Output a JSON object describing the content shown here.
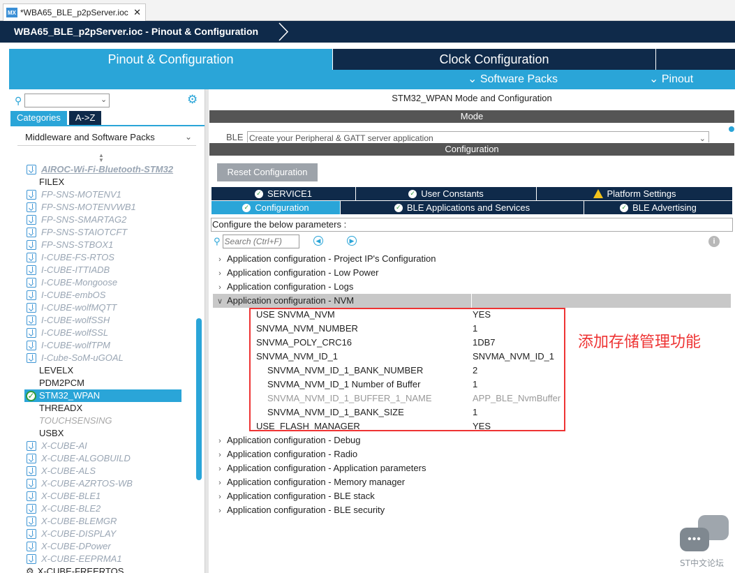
{
  "file_tab": {
    "logo": "MX",
    "title": "*WBA65_BLE_p2pServer.ioc",
    "close": "✕"
  },
  "breadcrumb": {
    "text": "WBA65_BLE_p2pServer.ioc - Pinout & Configuration"
  },
  "main_tabs": {
    "pinout_config": "Pinout & Configuration",
    "clock_config": "Clock Configuration"
  },
  "sub_menu": {
    "software_packs": "Software Packs",
    "pinout": "Pinout"
  },
  "left": {
    "category_tab": "Categories",
    "az_tab": "A->Z",
    "group": "Middleware and Software Packs",
    "tree": [
      {
        "label": "AIROC-Wi-Fi-Bluetooth-STM32",
        "kind": "dl-first"
      },
      {
        "label": "FILEX",
        "kind": "plain"
      },
      {
        "label": "FP-SNS-MOTENV1",
        "kind": "dl"
      },
      {
        "label": "FP-SNS-MOTENVWB1",
        "kind": "dl"
      },
      {
        "label": "FP-SNS-SMARTAG2",
        "kind": "dl"
      },
      {
        "label": "FP-SNS-STAIOTCFT",
        "kind": "dl"
      },
      {
        "label": "FP-SNS-STBOX1",
        "kind": "dl"
      },
      {
        "label": "I-CUBE-FS-RTOS",
        "kind": "dl"
      },
      {
        "label": "I-CUBE-ITTIADB",
        "kind": "dl"
      },
      {
        "label": "I-CUBE-Mongoose",
        "kind": "dl"
      },
      {
        "label": "I-CUBE-embOS",
        "kind": "dl"
      },
      {
        "label": "I-CUBE-wolfMQTT",
        "kind": "dl"
      },
      {
        "label": "I-CUBE-wolfSSH",
        "kind": "dl"
      },
      {
        "label": "I-CUBE-wolfSSL",
        "kind": "dl"
      },
      {
        "label": "I-CUBE-wolfTPM",
        "kind": "dl"
      },
      {
        "label": "I-Cube-SoM-uGOAL",
        "kind": "dl"
      },
      {
        "label": "LEVELX",
        "kind": "plain"
      },
      {
        "label": "PDM2PCM",
        "kind": "plain"
      },
      {
        "label": "STM32_WPAN",
        "kind": "selected"
      },
      {
        "label": "THREADX",
        "kind": "plain"
      },
      {
        "label": "TOUCHSENSING",
        "kind": "greyplain"
      },
      {
        "label": "USBX",
        "kind": "plain"
      },
      {
        "label": "X-CUBE-AI",
        "kind": "dl"
      },
      {
        "label": "X-CUBE-ALGOBUILD",
        "kind": "dl"
      },
      {
        "label": "X-CUBE-ALS",
        "kind": "dl"
      },
      {
        "label": "X-CUBE-AZRTOS-WB",
        "kind": "dl"
      },
      {
        "label": "X-CUBE-BLE1",
        "kind": "dl"
      },
      {
        "label": "X-CUBE-BLE2",
        "kind": "dl"
      },
      {
        "label": "X-CUBE-BLEMGR",
        "kind": "dl"
      },
      {
        "label": "X-CUBE-DISPLAY",
        "kind": "dl"
      },
      {
        "label": "X-CUBE-DPower",
        "kind": "dl"
      },
      {
        "label": "X-CUBE-EEPRMA1",
        "kind": "dl"
      },
      {
        "label": "X-CUBE-FREERTOS",
        "kind": "gear"
      }
    ]
  },
  "right": {
    "title": "STM32_WPAN Mode and Configuration",
    "mode_header": "Mode",
    "ble_label": "BLE",
    "ble_value": "Create your Peripheral & GATT server application",
    "config_header": "Configuration",
    "reset_button": "Reset Configuration",
    "tabs_row1": [
      "SERVICE1",
      "User Constants",
      "Platform Settings"
    ],
    "tabs_row2": [
      "Configuration",
      "BLE Applications and Services",
      "BLE Advertising"
    ],
    "params_label": "Configure the below parameters :",
    "search_placeholder": "Search (Ctrl+F)",
    "groups_before": [
      "Application configuration - Project IP's Configuration",
      "Application configuration - Low Power",
      "Application configuration - Logs"
    ],
    "open_group": "Application configuration - NVM",
    "nvm_params": [
      {
        "key": "USE SNVMA_NVM",
        "value": "YES",
        "indent": false,
        "dim": false
      },
      {
        "key": "SNVMA_NVM_NUMBER",
        "value": "1",
        "indent": false,
        "dim": false
      },
      {
        "key": "SNVMA_POLY_CRC16",
        "value": "1DB7",
        "indent": false,
        "dim": false
      },
      {
        "key": "SNVMA_NVM_ID_1",
        "value": "SNVMA_NVM_ID_1",
        "indent": false,
        "dim": false
      },
      {
        "key": "SNVMA_NVM_ID_1_BANK_NUMBER",
        "value": "2",
        "indent": true,
        "dim": false
      },
      {
        "key": "SNVMA_NVM_ID_1 Number of Buffer",
        "value": "1",
        "indent": true,
        "dim": false
      },
      {
        "key": "SNVMA_NVM_ID_1_BUFFER_1_NAME",
        "value": "APP_BLE_NvmBuffer",
        "indent": true,
        "dim": true
      },
      {
        "key": "SNVMA_NVM_ID_1_BANK_SIZE",
        "value": "1",
        "indent": true,
        "dim": false
      },
      {
        "key": "USE_FLASH_MANAGER",
        "value": "YES",
        "indent": false,
        "dim": false
      }
    ],
    "groups_after": [
      "Application configuration - Debug",
      "Application configuration - Radio",
      "Application configuration - Application parameters",
      "Application configuration - Memory manager",
      "Application configuration - BLE stack",
      "Application configuration - BLE security"
    ]
  },
  "annotation": "添加存储管理功能",
  "watermark": {
    "bubble": "•••",
    "text": "ST中文论坛"
  },
  "colors": {
    "accent": "#2aa5d8",
    "navy": "#0f2a4a",
    "annotation_red": "#e33333"
  }
}
